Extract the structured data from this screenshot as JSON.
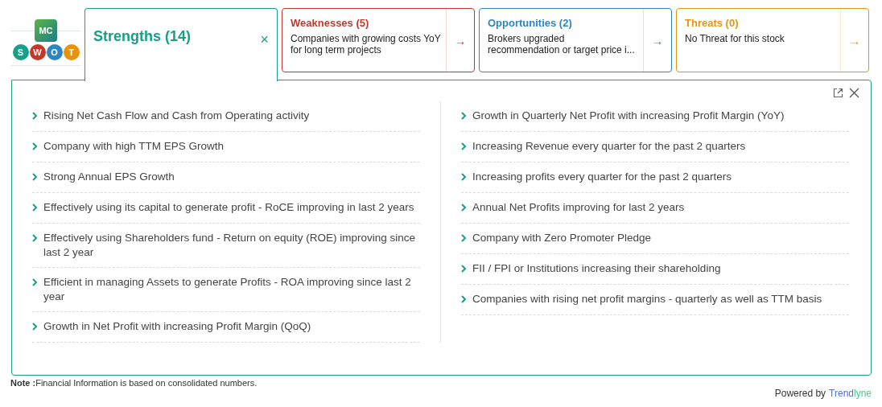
{
  "logo": {
    "badge": "MC",
    "letters": [
      {
        "letter": "S",
        "color": "#17a085"
      },
      {
        "letter": "W",
        "color": "#c0392b"
      },
      {
        "letter": "O",
        "color": "#2e86c1"
      },
      {
        "letter": "T",
        "color": "#e8930c"
      }
    ]
  },
  "tabs": [
    {
      "title": "Strengths (14)",
      "selected": true,
      "color": "#17a085",
      "close": "×"
    },
    {
      "title": "Weaknesses (5)",
      "selected": false,
      "color": "#c0392b",
      "summary": "Companies with growing costs YoY for long term projects",
      "arrow": "→"
    },
    {
      "title": "Opportunities (2)",
      "selected": false,
      "color": "#2e86c1",
      "summary": "Brokers upgraded recommendation or target price i...",
      "arrow": "→"
    },
    {
      "title": "Threats (0)",
      "selected": false,
      "color": "#e8930c",
      "summary": "No Threat for this stock",
      "arrow": "→"
    }
  ],
  "panel": {
    "columns": [
      [
        "Rising Net Cash Flow and Cash from Operating activity",
        "Company with high TTM EPS Growth",
        "Strong Annual EPS Growth",
        "Effectively using its capital to generate profit - RoCE improving in last 2 years",
        "Effectively using Shareholders fund - Return on equity (ROE) improving since last 2 year",
        "Efficient in managing Assets to generate Profits - ROA improving since last 2 year",
        "Growth in Net Profit with increasing Profit Margin (QoQ)"
      ],
      [
        "Growth in Quarterly Net Profit with increasing Profit Margin (YoY)",
        "Increasing Revenue every quarter for the past 2 quarters",
        "Increasing profits every quarter for the past 2 quarters",
        "Annual Net Profits improving for last 2 years",
        "Company with Zero Promoter Pledge",
        "FII / FPI or Institutions increasing their shareholding",
        "Companies with rising net profit margins - quarterly as well as TTM basis"
      ]
    ]
  },
  "note": "**Note :**Financial Information is based on consolidated numbers.",
  "footer": {
    "label": "Powered by",
    "brand_part_1": "Trend",
    "brand_part_2": "lyne"
  }
}
